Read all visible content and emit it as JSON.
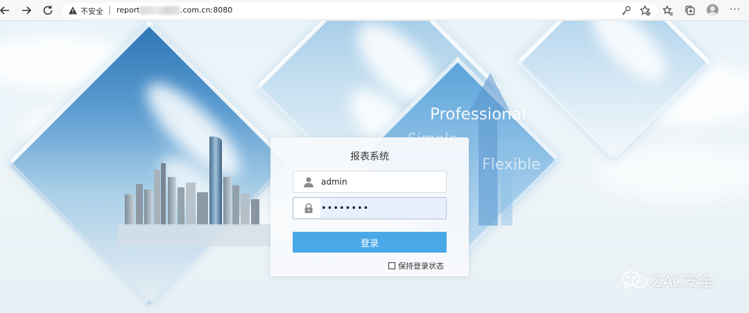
{
  "browser": {
    "address_security": "不安全",
    "address_separator": "|",
    "url_prefix": "report",
    "url_suffix": ".com.cn:8080"
  },
  "background": {
    "tagline_professional": "Professional",
    "tagline_simple": "Simple",
    "tagline_flexible": "Flexible"
  },
  "login": {
    "title": "报表系统",
    "username_value": "admin",
    "password_value": "••••••••",
    "submit_label": "登录",
    "remember_label": "保持登录状态"
  },
  "watermark": {
    "text": "ZAC安全"
  },
  "colors": {
    "accent": "#4aa8e8",
    "password_autofill_bg": "#e8f0fe"
  },
  "icons": {
    "back": "arrow-left-icon",
    "forward": "arrow-right-icon",
    "reload": "reload-icon",
    "warning": "warning-triangle-icon",
    "key": "key-icon",
    "favorite": "star-icon",
    "collections": "collections-icon",
    "user": "user-icon",
    "lock": "lock-icon",
    "watermark": "wechat-icon"
  }
}
